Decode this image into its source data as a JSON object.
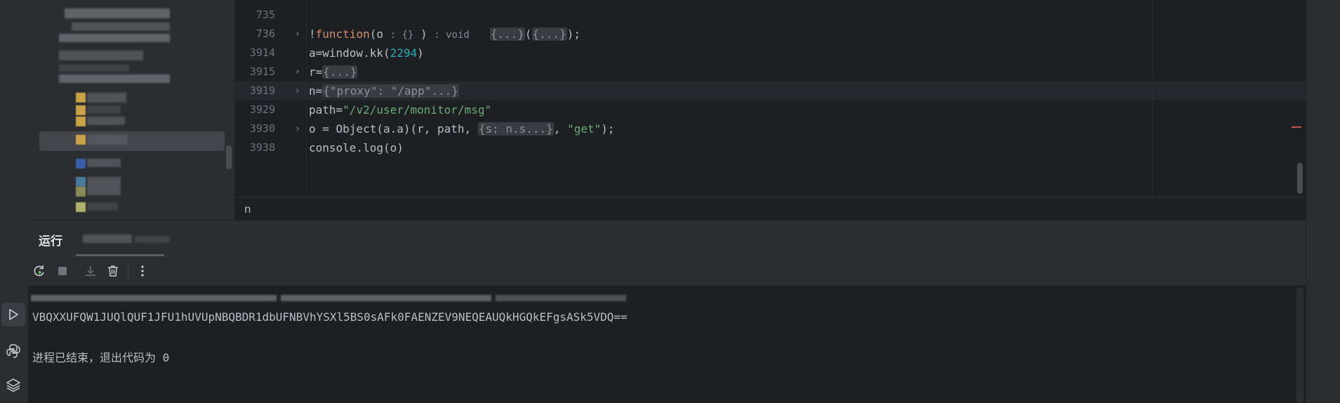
{
  "activity_bar": {
    "icons": [
      "run-icon",
      "python-console-icon",
      "layers-icon"
    ],
    "active_color": "#3b3d42"
  },
  "editor": {
    "lines": [
      {
        "num": "735"
      },
      {
        "num": "736"
      },
      {
        "num": "3914"
      },
      {
        "num": "3915"
      },
      {
        "num": "3919"
      },
      {
        "num": "3929"
      },
      {
        "num": "3930"
      },
      {
        "num": "3938"
      }
    ],
    "code": {
      "l736_bang": "!",
      "l736_kw": "function",
      "l736_open": "(o",
      "l736_hint1": ": {}",
      "l736_close": " )",
      "l736_hint2": ": void",
      "l736_fold1": "{...}",
      "l736_paren_open": "(",
      "l736_fold2": "{...}",
      "l736_end": ");",
      "l3914_pre": "a=window.kk(",
      "l3914_num": "2294",
      "l3914_post": ")",
      "l3915_pre": "r=",
      "l3915_fold": "{...}",
      "l3919_pre": "n=",
      "l3919_fold": "{\"proxy\": \"/app\"...}",
      "l3929_pre": "path=",
      "l3929_str": "\"/v2/user/monitor/msg\"",
      "l3930_pre": "o = Object(a.a)(r, path, ",
      "l3930_fold": "{s: n.s...}",
      "l3930_mid": ", ",
      "l3930_str": "\"get\"",
      "l3930_end": ");",
      "l3938": "console.log(o)"
    },
    "colors": {
      "keyword": "#cf8e6d",
      "number": "#2aacb8",
      "string": "#6aab73",
      "text": "#bcbec4"
    }
  },
  "breadcrumb": {
    "item": "n"
  },
  "run_window": {
    "title": "运行",
    "toolbar": [
      "rerun-icon",
      "stop-icon",
      "scroll-to-end-icon",
      "clear-all-icon",
      "more-options-icon"
    ]
  },
  "console": {
    "output": "VBQXXUFQW1JUQlQUF1JFU1hUVUpNBQBDR1dbUFNBVhYSXl5BS0sAFk0FAENZEV9NEQEAUQkHGQkEFgsASk5VDQ==",
    "exit_message": "进程已结束，退出代码为 0"
  }
}
